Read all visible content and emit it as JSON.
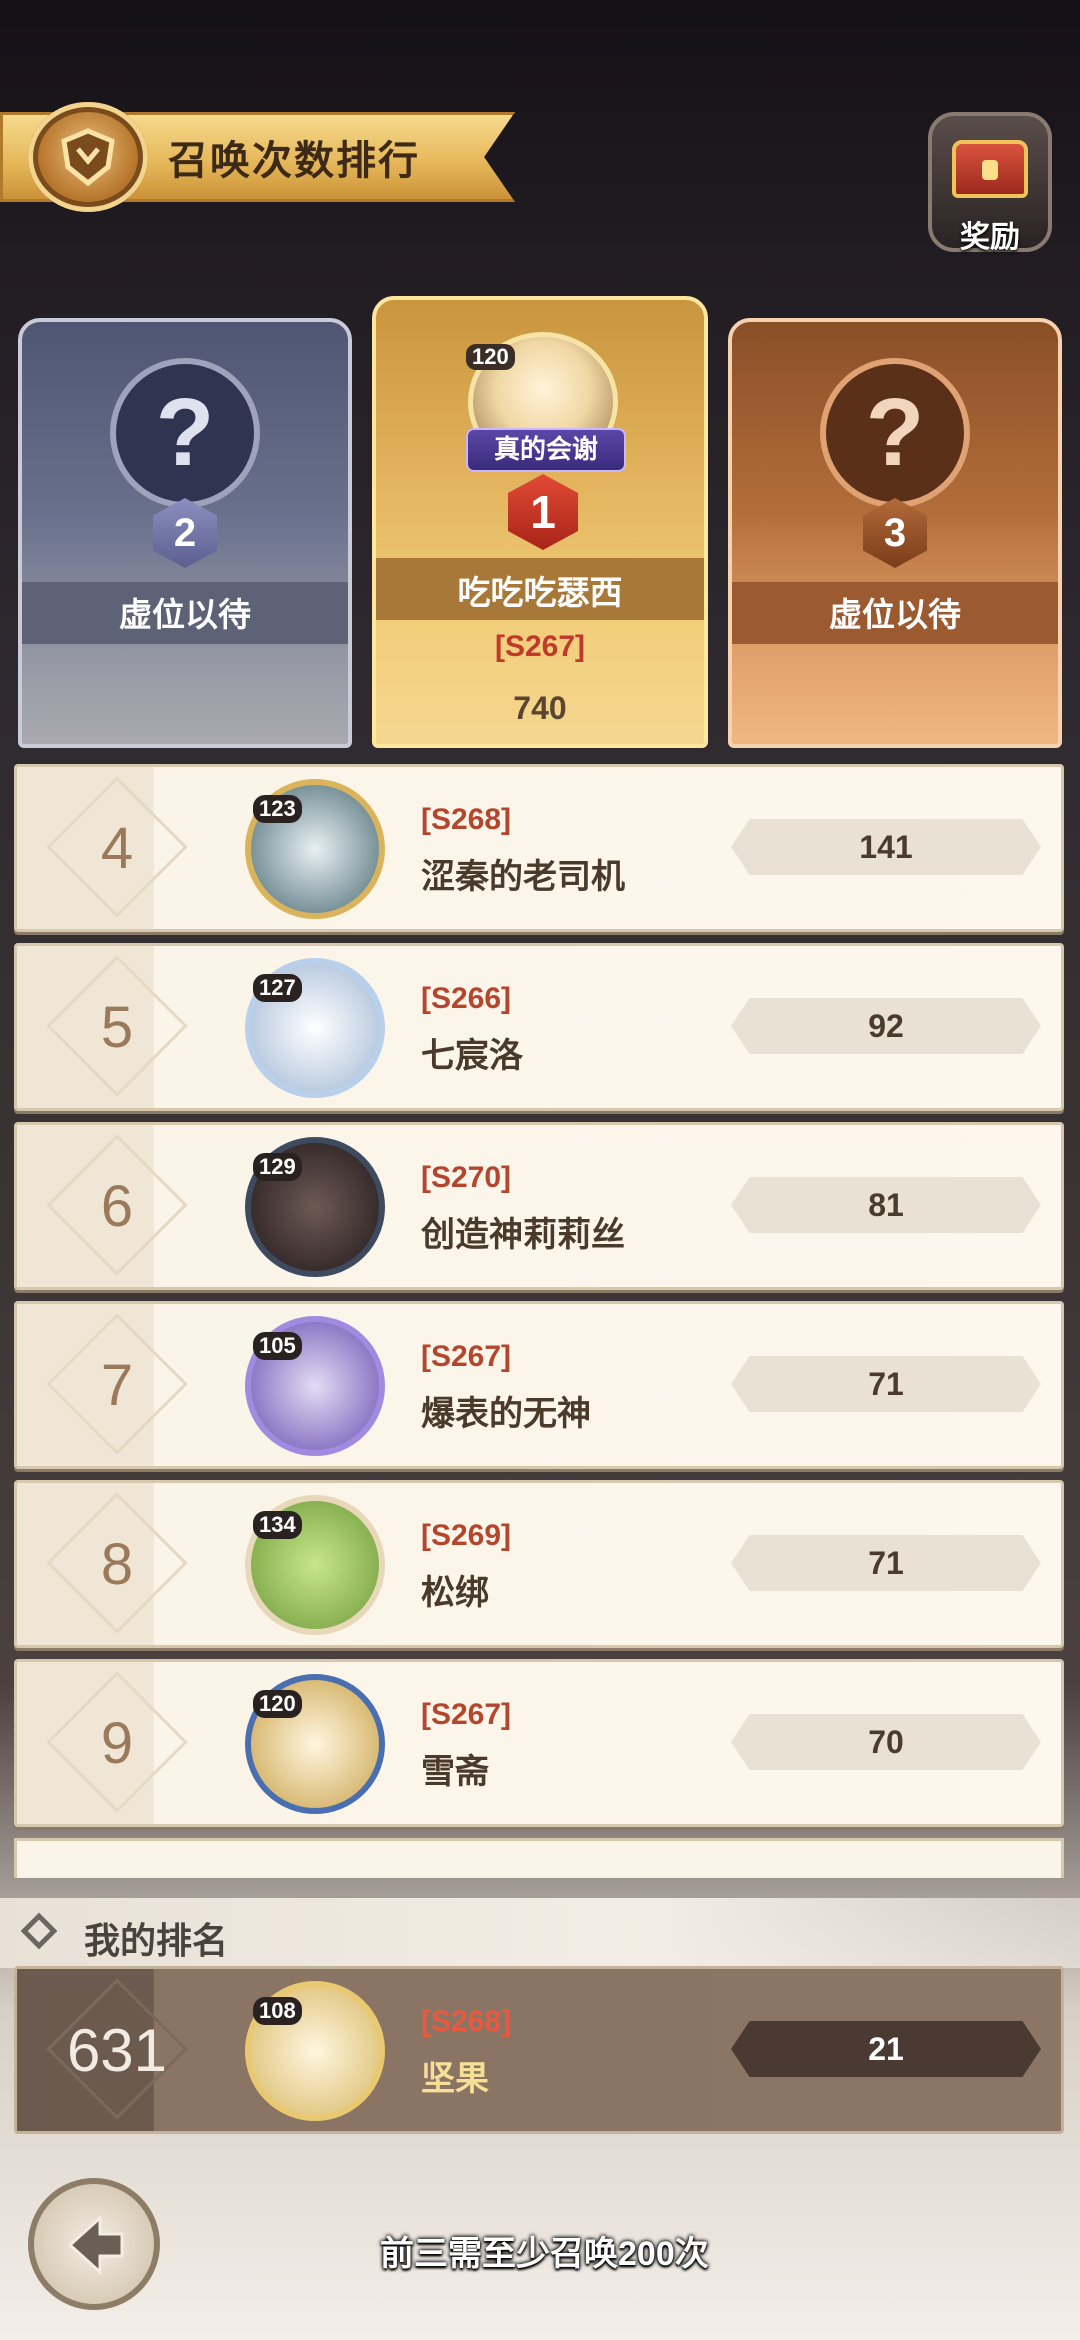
{
  "header": {
    "title": "召唤次数排行"
  },
  "reward_button": {
    "label": "奖励"
  },
  "podium": {
    "second": {
      "rank": "2",
      "placeholder": "?",
      "name": "虚位以待"
    },
    "first": {
      "rank": "1",
      "level": "120",
      "title_tag": "真的会谢",
      "name": "吃吃吃瑟西",
      "server": "[S267]",
      "value": "740"
    },
    "third": {
      "rank": "3",
      "placeholder": "?",
      "name": "虚位以待"
    }
  },
  "rankings": [
    {
      "rank": "4",
      "level": "123",
      "server": "[S268]",
      "name": "涩秦的老司机",
      "value": "141"
    },
    {
      "rank": "5",
      "level": "127",
      "server": "[S266]",
      "name": "七宸洛",
      "value": "92"
    },
    {
      "rank": "6",
      "level": "129",
      "server": "[S270]",
      "name": "创造神莉莉丝",
      "value": "81"
    },
    {
      "rank": "7",
      "level": "105",
      "server": "[S267]",
      "name": "爆表的无神",
      "value": "71"
    },
    {
      "rank": "8",
      "level": "134",
      "server": "[S269]",
      "name": "松绑",
      "value": "71"
    },
    {
      "rank": "9",
      "level": "120",
      "server": "[S267]",
      "name": "雪斋",
      "value": "70"
    }
  ],
  "my_rank": {
    "label": "我的排名",
    "rank": "631",
    "level": "108",
    "server": "[S268]",
    "name": "坚果",
    "value": "21"
  },
  "footer": {
    "note": "前三需至少召唤200次"
  },
  "colors": {
    "gold": "#e6b85b",
    "silver": "#68708c",
    "bronze": "#b36d3a",
    "server_red": "#b5462e"
  },
  "icons": {
    "title_emblem": "shield-emblem-icon",
    "reward": "treasure-chest-icon",
    "back": "back-arrow-icon"
  }
}
